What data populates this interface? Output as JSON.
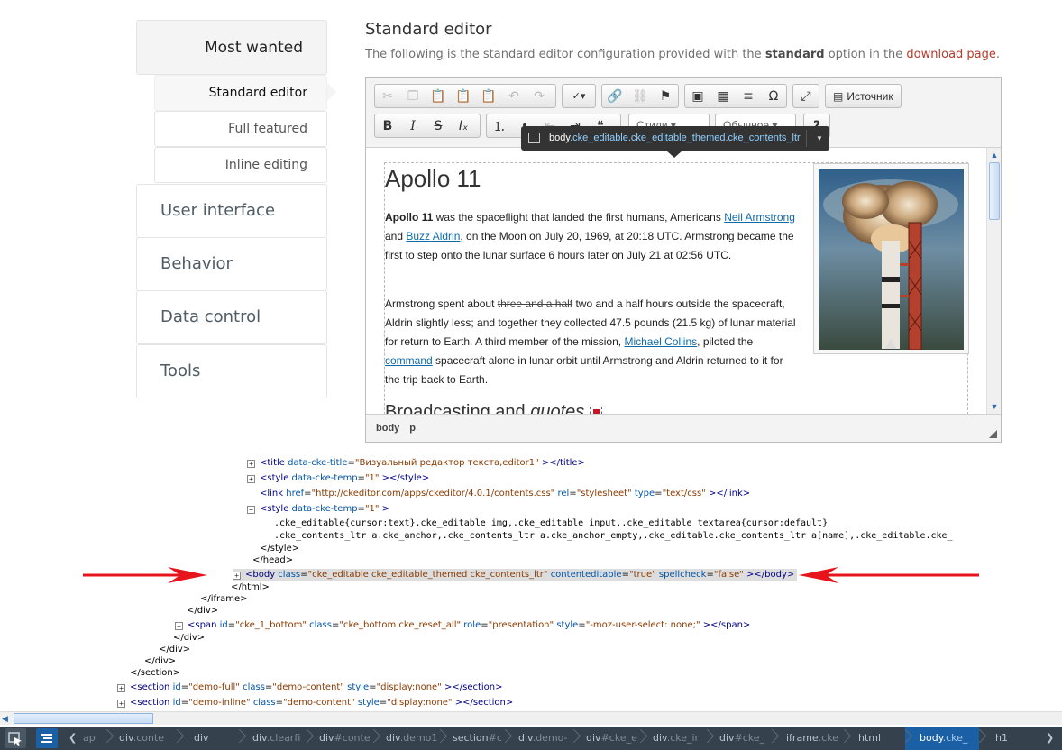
{
  "sidebar": {
    "most_wanted": "Most wanted",
    "standard_editor": "Standard editor",
    "full_featured": "Full featured",
    "inline_editing": "Inline editing",
    "user_interface": "User interface",
    "behavior": "Behavior",
    "data_control": "Data control",
    "tools": "Tools"
  },
  "heading": {
    "title": "Standard editor",
    "desc_pre": "The following is the standard editor configuration provided with the ",
    "desc_bold": "standard",
    "desc_mid": " option in the ",
    "desc_link": "download page",
    "desc_end": "."
  },
  "toolbar": {
    "source_label": "Источник",
    "styles_label": "Стили",
    "format_label": "Обычное",
    "help": "?"
  },
  "tooltip": {
    "tag": "body",
    "selector": ".cke_editable.cke_editable_themed.cke_contents_ltr"
  },
  "document": {
    "h1": "Apollo 11",
    "p1_bold": "Apollo 11",
    "p1_a": " was the spaceflight that landed the first humans, Americans ",
    "p1_link1": "Neil Armstrong",
    "p1_b": " and ",
    "p1_link2": "Buzz Aldrin",
    "p1_c": ", on the Moon on July 20, 1969, at 20:18 UTC. Armstrong became the first to step onto the lunar surface 6 hours later on July 21 at 02:56 UTC.",
    "p2_a": "Armstrong spent about ",
    "p2_strike": "three and a half",
    "p2_b": " two and a half hours outside the spacecraft, Aldrin slightly less; and together they collected 47.5 pounds (21.5 kg) of lunar material for return to Earth. A third member of the mission, ",
    "p2_link1": "Michael Collins",
    "p2_c": ", piloted the ",
    "p2_link2": "command",
    "p2_d": " spacecraft alone in lunar orbit until Armstrong and Aldrin returned to it for the trip back to Earth.",
    "h2_plain": "Broadcasting and ",
    "h2_italic": "quotes"
  },
  "pathbar": [
    "body",
    "p"
  ],
  "devtools": {
    "lines": [
      {
        "kind": "title",
        "text_pre": "<title ",
        "attr1": "data-cke-title",
        "val1": "\"Визуальный редактор текста,editor1\"",
        "text_post": " ></title>"
      },
      {
        "kind": "style",
        "text_pre": "<style ",
        "attr1": "data-cke-temp",
        "val1": "\"1\"",
        "text_post": " ></style>"
      },
      {
        "kind": "link",
        "text_pre": "<link ",
        "attr1": "href",
        "val1": "\"http://ckeditor.com/apps/ckeditor/4.0.1/contents.css\"",
        "attr2": "rel",
        "val2": "\"stylesheet\"",
        "attr3": "type",
        "val3": "\"text/css\"",
        "text_post": " ></link>"
      },
      {
        "kind": "style2",
        "text_pre": "<style ",
        "attr1": "data-cke-temp",
        "val1": "\"1\"",
        "text_post": " >"
      }
    ],
    "css1": ".cke_editable{cursor:text}.cke_editable img,.cke_editable input,.cke_editable textarea{cursor:default}",
    "css2": ".cke_contents_ltr a.cke_anchor,.cke_contents_ltr a.cke_anchor_empty,.cke_editable.cke_contents_ltr a[name],.cke_editable.cke_",
    "close_style": "</style>",
    "close_head": "</head>",
    "body_line": {
      "pre": "<body ",
      "a1": "class",
      "v1": "\"cke_editable cke_editable_themed cke_contents_ltr\"",
      "a2": "contenteditable",
      "v2": "\"true\"",
      "a3": "spellcheck",
      "v3": "\"false\"",
      "post": " ></body>"
    },
    "close_html": "</html>",
    "close_iframe": "</iframe>",
    "close_div1": "</div>",
    "span_line": {
      "pre": "<span ",
      "a1": "id",
      "v1": "\"cke_1_bottom\"",
      "a2": "class",
      "v2": "\"cke_bottom cke_reset_all\"",
      "a3": "role",
      "v3": "\"presentation\"",
      "a4": "style",
      "v4": "\"-moz-user-select: none;\"",
      "post": " ></span>"
    },
    "close_div2": "</div>",
    "close_div3": "</div>",
    "close_div4": "</div>",
    "close_section": "</section>",
    "section_full": {
      "pre": "<section ",
      "a1": "id",
      "v1": "\"demo-full\"",
      "a2": "class",
      "v2": "\"demo-content\"",
      "a3": "style",
      "v3": "\"display:none\"",
      "post": " ></section>"
    },
    "section_inline": {
      "pre": "<section ",
      "a1": "id",
      "v1": "\"demo-inline\"",
      "a2": "class",
      "v2": "\"demo-content\"",
      "a3": "style",
      "v3": "\"display:none\"",
      "post": " ></section>"
    }
  },
  "breadcrumbs": [
    {
      "main": "ap",
      "dim": ""
    },
    {
      "main": "div",
      "dim": ".conte"
    },
    {
      "main": "div",
      "dim": ""
    },
    {
      "main": "div",
      "dim": ".clearfi"
    },
    {
      "main": "div",
      "dim": "#conte"
    },
    {
      "main": "div",
      "dim": ".demo1"
    },
    {
      "main": "section",
      "dim": "#c"
    },
    {
      "main": "div",
      "dim": ".demo-"
    },
    {
      "main": "div",
      "dim": "#cke_e"
    },
    {
      "main": "div",
      "dim": ".cke_ir"
    },
    {
      "main": "div",
      "dim": "#cke_"
    },
    {
      "main": "iframe",
      "dim": ".cke"
    },
    {
      "main": "html",
      "dim": ""
    },
    {
      "main": "body",
      "dim": ".cke_"
    },
    {
      "main": "h1",
      "dim": ""
    }
  ],
  "colors": {
    "accent_link": "#b53b2b",
    "devtools_bar": "#35424d",
    "selected_crumb": "#1b5fa4",
    "arrow_red": "#e8141b"
  }
}
